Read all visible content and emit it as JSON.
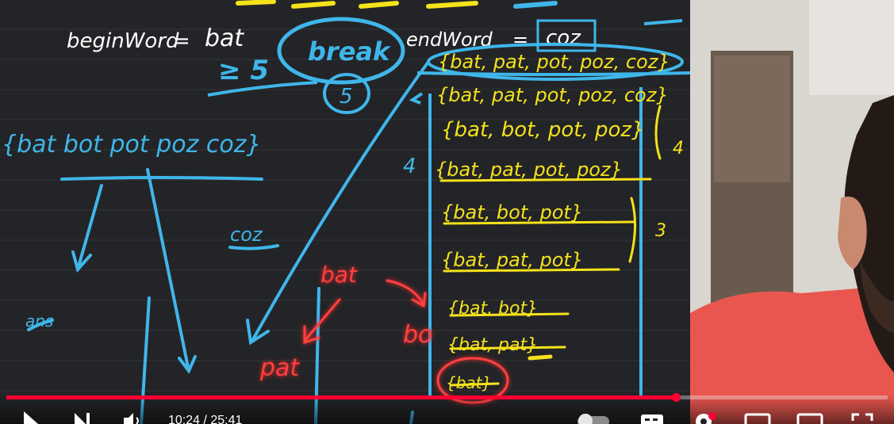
{
  "player": {
    "time_display": "10:24 / 25:41",
    "progress_fraction": 0.76,
    "accent_color": "#ff0033"
  },
  "controls": {
    "play_icon": "play-icon",
    "next_icon": "next-icon",
    "volume_icon": "volume-icon",
    "autoplay_icon": "autoplay-toggle-icon",
    "captions_icon": "captions-icon",
    "settings_icon": "gear-icon",
    "miniplayer_icon": "miniplayer-icon",
    "theater_icon": "theater-mode-icon",
    "fullscreen_icon": "fullscreen-icon"
  },
  "whiteboard": {
    "begin_word_label": "beginWord",
    "equals_1": "=",
    "begin_word_value": "bat",
    "end_word_label": "endWord",
    "equals_2": "=",
    "end_word_value": "coz",
    "break_note": "break",
    "ge5_note": "≥ 5",
    "five_note": "5",
    "word_set": "{bat bot pot poz coz}",
    "coz_label": "coz",
    "ans_label": "ans",
    "set_rows": [
      "{bat, pat, pot, poz, coz}",
      "{bat, pat, pot, poz, coz}",
      "{bat, bot, pot, poz}",
      "{bat, pat, pot, poz}",
      "{bat, bot, pot}",
      "{bat, pat, pot}",
      "{bat, bot}",
      "{bat, pat}",
      "{bat}"
    ],
    "count_4_left": "4",
    "count_4_right": "4",
    "count_3": "3",
    "red_bat": "bat",
    "red_pat": "pat",
    "red_bo": "bo"
  }
}
